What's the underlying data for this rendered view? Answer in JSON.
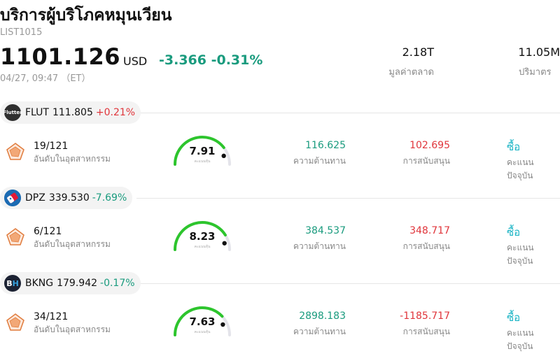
{
  "header": {
    "title": "บริการผู้บริโภคหมุนเวียน",
    "code": "LIST1015",
    "price": "1101.126",
    "currency": "USD",
    "change": "-3.366",
    "change_pct": "-0.31%",
    "time": "04/27, 09:47 （ET）",
    "market_cap": "2.18T",
    "market_cap_label": "มูลค่าตลาด",
    "volume": "11.05M",
    "volume_label": "ปริมาตร"
  },
  "colors": {
    "up": "#e0353b",
    "down": "#1a9b7e",
    "accent": "#17b3c4",
    "gauge": "#2dc52d"
  },
  "stocks": [
    {
      "symbol": "FLUT",
      "price": "111.805",
      "change_pct": "+0.21%",
      "direction": "up",
      "logo_icon": "flutter-logo-icon",
      "logo_text": "Flutter",
      "logo_bg": "#2f2f2f",
      "rank": "19/121",
      "rank_label": "อันดับในอุตสาหกรรม",
      "score": "7.91",
      "score_fraction": 0.79,
      "score_label": "คะแนนหุ้น",
      "resistance": "116.625",
      "resistance_label": "ความต้านทาน",
      "support": "102.695",
      "support_label": "การสนับสนุน",
      "rating": "ซื้อ",
      "rating_label": "คะแนนปัจจุบัน"
    },
    {
      "symbol": "DPZ",
      "price": "339.530",
      "change_pct": "-7.69%",
      "direction": "down",
      "logo_icon": "domino-logo-icon",
      "logo_text": "",
      "logo_bg": "#1b6bb3",
      "rank": "6/121",
      "rank_label": "อันดับในอุตสาหกรรม",
      "score": "8.23",
      "score_fraction": 0.82,
      "score_label": "คะแนนหุ้น",
      "resistance": "384.537",
      "resistance_label": "ความต้านทาน",
      "support": "348.717",
      "support_label": "การสนับสนุน",
      "rating": "ซื้อ",
      "rating_label": "คะแนนปัจจุบัน"
    },
    {
      "symbol": "BKNG",
      "price": "179.942",
      "change_pct": "-0.17%",
      "direction": "down",
      "logo_icon": "booking-logo-icon",
      "logo_text": "BH",
      "logo_bg": "#1c2233",
      "rank": "34/121",
      "rank_label": "อันดับในอุตสาหกรรม",
      "score": "7.63",
      "score_fraction": 0.76,
      "score_label": "คะแนนหุ้น",
      "resistance": "2898.183",
      "resistance_label": "ความต้านทาน",
      "support": "-1185.717",
      "support_label": "การสนับสนุน",
      "rating": "ซื้อ",
      "rating_label": "คะแนนปัจจุบัน"
    }
  ]
}
